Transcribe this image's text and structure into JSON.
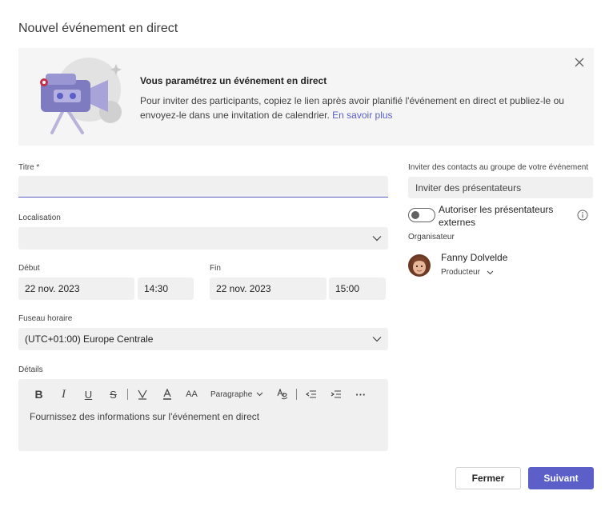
{
  "dialog": {
    "title": "Nouvel événement en direct"
  },
  "banner": {
    "title": "Vous paramétrez un événement en direct",
    "text": "Pour inviter des participants, copiez le lien après avoir planifié l'événement en direct et publiez-le ou envoyez-le dans une invitation de calendrier.",
    "link": "En savoir plus",
    "illustration_icon": "video-camera-illustration",
    "close_icon": "close-icon"
  },
  "form": {
    "title_label": "Titre *",
    "title_value": "",
    "location_label": "Localisation",
    "location_value": "",
    "start_label": "Début",
    "start_date": "22 nov. 2023",
    "start_time": "14:30",
    "end_label": "Fin",
    "end_date": "22 nov. 2023",
    "end_time": "15:00",
    "timezone_label": "Fuseau horaire",
    "timezone_value": "(UTC+01:00) Europe Centrale",
    "details_label": "Détails",
    "details_placeholder": "Fournissez des informations sur l'événement en direct",
    "toolbar": {
      "bold": "B",
      "italic": "I",
      "underline": "U",
      "strike": "S",
      "font_size": "AA",
      "paragraph": "Paragraphe",
      "more": "···"
    }
  },
  "side": {
    "invite_label": "Inviter des contacts au groupe de votre événement",
    "invite_placeholder": "Inviter des présentateurs",
    "toggle_label": "Autoriser les présentateurs externes",
    "toggle_on": false,
    "organizer_label": "Organisateur",
    "organizer_name": "Fanny Dolvelde",
    "organizer_role": "Producteur"
  },
  "footer": {
    "close_label": "Fermer",
    "next_label": "Suivant"
  },
  "colors": {
    "accent": "#5b5fc7",
    "field_bg": "#f0f0f0",
    "banner_bg": "#f5f5f5"
  }
}
